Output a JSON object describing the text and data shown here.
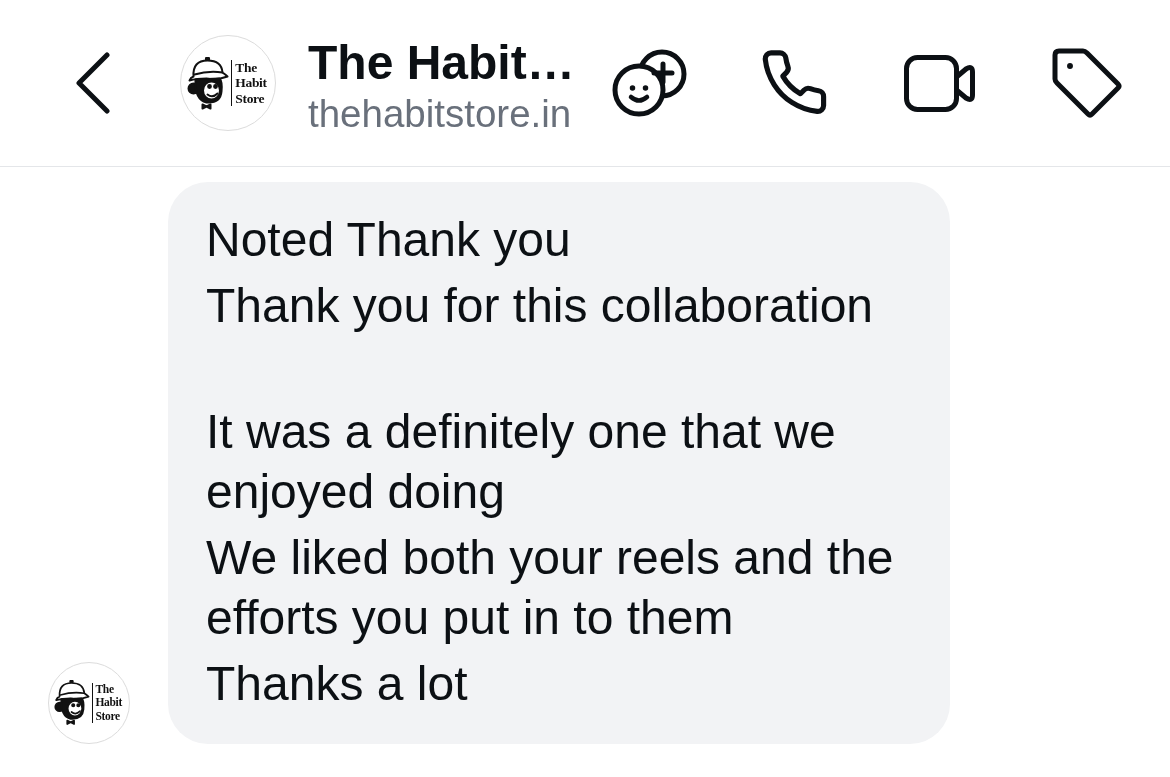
{
  "header": {
    "avatar": {
      "logo_text": "The Habit Store"
    },
    "title": "The Habit…",
    "subtitle": "thehabitstore.in"
  },
  "message": {
    "avatar": {
      "logo_text": "The Habit Store"
    },
    "paragraphs": [
      {
        "lines": [
          "Noted Thank you",
          "Thank you for this collaboration"
        ]
      },
      {
        "lines": [
          "It was a definitely one that we enjoyed doing",
          "We liked both your reels and the efforts you put in to them",
          "Thanks a lot"
        ]
      }
    ]
  }
}
